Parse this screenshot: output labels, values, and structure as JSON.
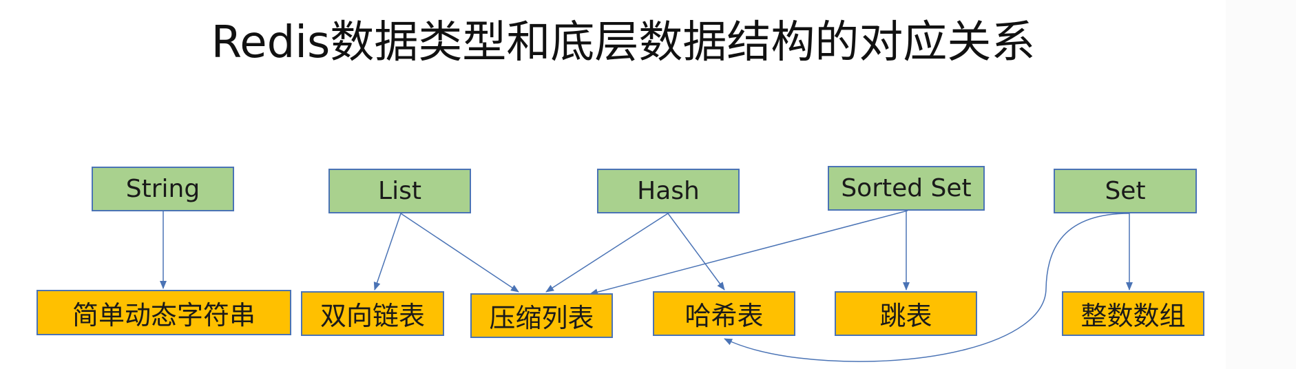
{
  "title": "Redis数据类型和底层数据结构的对应关系",
  "colors": {
    "type_fill": "#a9d18e",
    "struct_fill": "#ffc000",
    "border": "#4a73b5",
    "connector": "#4a73b5"
  },
  "types": {
    "string": "String",
    "list": "List",
    "hash": "Hash",
    "sorted_set": "Sorted Set",
    "set": "Set"
  },
  "structures": {
    "sds": "简单动态字符串",
    "linkedlist": "双向链表",
    "ziplist": "压缩列表",
    "hashtable": "哈希表",
    "skiplist": "跳表",
    "intset": "整数数组"
  },
  "relations": [
    {
      "from": "String",
      "to": "简单动态字符串"
    },
    {
      "from": "List",
      "to": "双向链表"
    },
    {
      "from": "List",
      "to": "压缩列表"
    },
    {
      "from": "Hash",
      "to": "压缩列表"
    },
    {
      "from": "Hash",
      "to": "哈希表"
    },
    {
      "from": "Sorted Set",
      "to": "压缩列表"
    },
    {
      "from": "Sorted Set",
      "to": "跳表"
    },
    {
      "from": "Set",
      "to": "哈希表"
    },
    {
      "from": "Set",
      "to": "整数数组"
    }
  ]
}
